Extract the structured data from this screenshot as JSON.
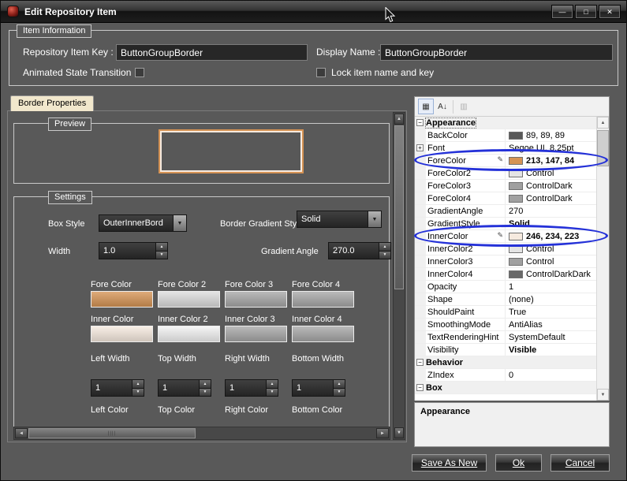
{
  "colors": {
    "dialog_bg": "#595959",
    "accent_orange": "#D59354",
    "accent_cream": "#F6EADF",
    "tab_bg": "#F1E7CC",
    "annotation_blue": "#2431D8"
  },
  "icons": {
    "minimize": "—",
    "maximize": "□",
    "close": "✕",
    "combo_arrow": "▼",
    "spin_up": "▲",
    "spin_down": "▼",
    "scroll_left": "◄",
    "scroll_right": "►",
    "scroll_up": "▲",
    "scroll_down": "▼",
    "categorized": "▦",
    "alphabetical": "A↓",
    "property_pages": "▥",
    "expand_plus": "+",
    "collapse_minus": "−",
    "editor_pencil": "✎",
    "thumb_grip": "||||"
  },
  "window": {
    "title": "Edit Repository Item"
  },
  "item_information": {
    "group_label": "Item Information",
    "repository_item_key_label": "Repository Item Key :",
    "repository_item_key_value": "ButtonGroupBorder",
    "display_name_label": "Display Name :",
    "display_name_value": "ButtonGroupBorder",
    "animated_state_transition_label": "Animated State Transition",
    "animated_state_transition_checked": false,
    "lock_item_label": "Lock item name and key",
    "lock_item_checked": false
  },
  "tabs": {
    "border_properties": "Border Properties"
  },
  "preview": {
    "group_label": "Preview"
  },
  "settings": {
    "group_label": "Settings",
    "box_style_label": "Box Style",
    "box_style_value": "OuterInnerBord",
    "border_gradient_style_label": "Border Gradient Style",
    "border_gradient_style_value": "Solid",
    "width_label": "Width",
    "width_value": "1.0",
    "gradient_angle_label": "Gradient Angle",
    "gradient_angle_value": "270.0",
    "fore_colors": [
      {
        "label": "Fore Color",
        "color": "#D59354"
      },
      {
        "label": "Fore Color 2",
        "color": "#DCDCDC"
      },
      {
        "label": "Fore Color 3",
        "color": "#A6A6A6"
      },
      {
        "label": "Fore Color 4",
        "color": "#A6A6A6"
      }
    ],
    "inner_colors": [
      {
        "label": "Inner Color",
        "color": "#F6EADF"
      },
      {
        "label": "Inner Color 2",
        "color": "#F2F2F2"
      },
      {
        "label": "Inner Color 3",
        "color": "#A6A6A6"
      },
      {
        "label": "Inner Color 4",
        "color": "#A6A6A6"
      }
    ],
    "widths": [
      {
        "label": "Left Width",
        "value": "1"
      },
      {
        "label": "Top Width",
        "value": "1"
      },
      {
        "label": "Right Width",
        "value": "1"
      },
      {
        "label": "Bottom Width",
        "value": "1"
      }
    ],
    "side_colors": [
      {
        "label": "Left Color"
      },
      {
        "label": "Top Color"
      },
      {
        "label": "Right Color"
      },
      {
        "label": "Bottom Color"
      }
    ]
  },
  "property_grid": {
    "rows": [
      {
        "type": "category",
        "name": "Appearance"
      },
      {
        "type": "color",
        "name": "BackColor",
        "value": "89, 89, 89",
        "swatch": "#595959"
      },
      {
        "type": "expandable",
        "name": "Font",
        "value": "Segoe UI, 8.25pt"
      },
      {
        "type": "color",
        "name": "ForeColor",
        "value": "213, 147, 84",
        "swatch": "#D59354",
        "bold": true,
        "editor": true
      },
      {
        "type": "color",
        "name": "ForeColor2",
        "value": "Control",
        "swatch": "#E4E4E4"
      },
      {
        "type": "color",
        "name": "ForeColor3",
        "value": "ControlDark",
        "swatch": "#A0A0A0"
      },
      {
        "type": "color",
        "name": "ForeColor4",
        "value": "ControlDark",
        "swatch": "#A0A0A0"
      },
      {
        "type": "text",
        "name": "GradientAngle",
        "value": "270"
      },
      {
        "type": "text",
        "name": "GradientStyle",
        "value": "Solid",
        "bold": true
      },
      {
        "type": "color",
        "name": "InnerColor",
        "value": "246, 234, 223",
        "swatch": "#F6EADF",
        "bold": true,
        "editor": true
      },
      {
        "type": "color",
        "name": "InnerColor2",
        "value": "Control",
        "swatch": "#E4E4E4"
      },
      {
        "type": "color",
        "name": "InnerColor3",
        "value": "Control",
        "swatch": "#A0A0A0"
      },
      {
        "type": "color",
        "name": "InnerColor4",
        "value": "ControlDarkDark",
        "swatch": "#696969"
      },
      {
        "type": "text",
        "name": "Opacity",
        "value": "1"
      },
      {
        "type": "text",
        "name": "Shape",
        "value": "(none)"
      },
      {
        "type": "text",
        "name": "ShouldPaint",
        "value": "True"
      },
      {
        "type": "text",
        "name": "SmoothingMode",
        "value": "AntiAlias"
      },
      {
        "type": "text",
        "name": "TextRenderingHint",
        "value": "SystemDefault"
      },
      {
        "type": "text",
        "name": "Visibility",
        "value": "Visible",
        "bold": true
      },
      {
        "type": "category",
        "name": "Behavior"
      },
      {
        "type": "text",
        "name": "ZIndex",
        "value": "0"
      },
      {
        "type": "category",
        "name": "Box"
      }
    ],
    "description_title": "Appearance"
  },
  "footer": {
    "save_as_new": "Save As New",
    "ok": "Ok",
    "cancel": "Cancel"
  }
}
